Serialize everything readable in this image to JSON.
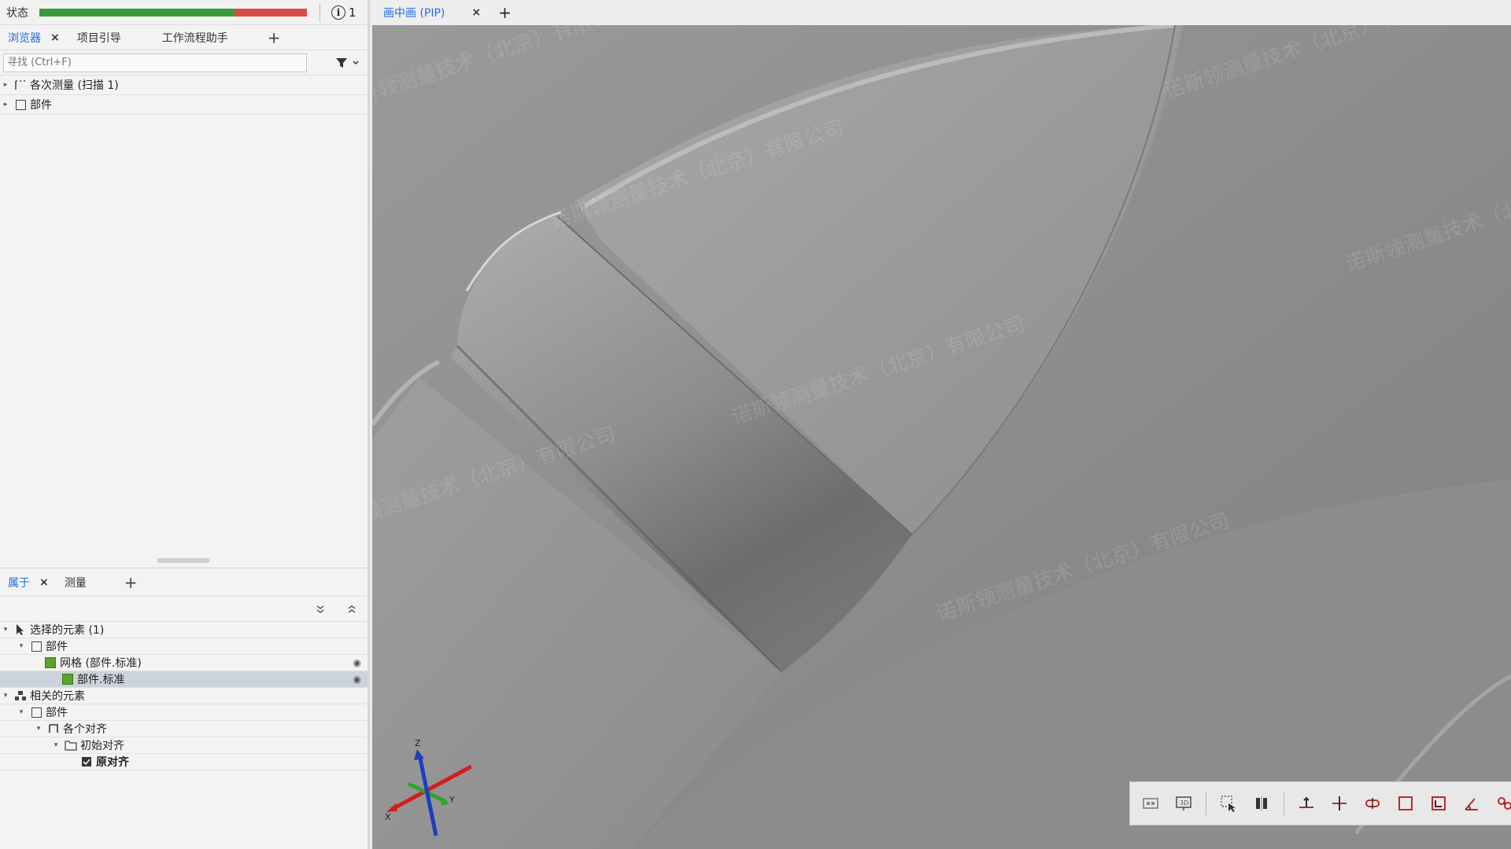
{
  "status": {
    "label": "状态",
    "progress_good_fraction": 0.73,
    "info_count": "1",
    "colors": {
      "good": "#3a9b3a",
      "bad": "#d84a4a"
    }
  },
  "left_tabs": {
    "items": [
      {
        "label": "浏览器"
      },
      {
        "label": "项目引导"
      },
      {
        "label": "工作流程助手"
      }
    ],
    "add": "+",
    "close": "×"
  },
  "search": {
    "placeholder": "寻找 (Ctrl+F)"
  },
  "browser_tree": [
    {
      "label": "各次测量 (扫描 1)"
    },
    {
      "label": "部件"
    }
  ],
  "props_tabs": {
    "items": [
      {
        "label": "属于"
      },
      {
        "label": "测量"
      }
    ],
    "add": "+",
    "close": "×",
    "collapse_all": "⌄",
    "expand_all": "⌃"
  },
  "props_tree": [
    {
      "label": "选择的元素 (1)"
    },
    {
      "label": "部件"
    },
    {
      "label": "网格 (部件.标准)"
    },
    {
      "label": "部件.标准"
    },
    {
      "label": "相关的元素"
    },
    {
      "label": "部件"
    },
    {
      "label": "各个对齐"
    },
    {
      "label": "初始对齐"
    },
    {
      "label": "原对齐"
    }
  ],
  "view_tabs": {
    "items": [
      {
        "label": "画中画 (PIP)"
      }
    ],
    "close": "×",
    "add": "+"
  },
  "watermark": "诺斯领测量技术（北京）有限公司",
  "triad": {
    "x": "X",
    "y": "Y",
    "z": "Z"
  },
  "toolbar_icons": [
    "screenshot-icon",
    "projector-icon",
    "select-box-icon",
    "split-icon",
    "align-icon",
    "point-icon",
    "slot-icon",
    "rectangle-icon",
    "frame-icon",
    "angle-icon",
    "chain-icon",
    "grid-icon",
    "fit-icon",
    "check-icon",
    "delete-icon",
    "transform-icon"
  ]
}
